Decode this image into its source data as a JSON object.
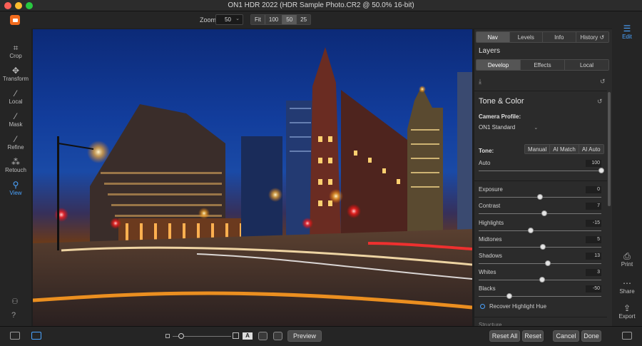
{
  "window": {
    "title": "ON1 HDR 2022 (HDR Sample Photo.CR2 @ 50.0% 16-bit)"
  },
  "toolbar": {
    "zoom_label": "Zoom",
    "zoom_value": "50",
    "zoom_presets": [
      "Fit",
      "100",
      "50",
      "25"
    ]
  },
  "left_tools": [
    {
      "label": "Crop",
      "icon": "crop-icon"
    },
    {
      "label": "Transform",
      "icon": "transform-icon"
    },
    {
      "label": "Local",
      "icon": "brush-icon"
    },
    {
      "label": "Mask",
      "icon": "mask-brush-icon"
    },
    {
      "label": "Refine",
      "icon": "refine-brush-icon"
    },
    {
      "label": "Retouch",
      "icon": "retouch-icon"
    },
    {
      "label": "View",
      "icon": "view-zoom-icon"
    }
  ],
  "panel": {
    "tabs": [
      "Nav",
      "Levels",
      "Info",
      "History"
    ],
    "layers_title": "Layers",
    "subtabs": [
      "Develop",
      "Effects",
      "Local"
    ],
    "section_title": "Tone & Color",
    "camera_profile_label": "Camera Profile:",
    "camera_profile_value": "ON1 Standard",
    "tone_label": "Tone:",
    "tone_buttons": [
      "Manual",
      "AI Match",
      "AI Auto"
    ],
    "sliders": [
      {
        "name": "Auto",
        "value": "100",
        "position": 1.0
      },
      {
        "name": "Exposure",
        "value": "0",
        "position": 0.5
      },
      {
        "name": "Contrast",
        "value": "7",
        "position": 0.535
      },
      {
        "name": "Highlights",
        "value": "-15",
        "position": 0.425
      },
      {
        "name": "Midtones",
        "value": "5",
        "position": 0.525
      },
      {
        "name": "Shadows",
        "value": "13",
        "position": 0.565
      },
      {
        "name": "Whites",
        "value": "3",
        "position": 0.515
      },
      {
        "name": "Blacks",
        "value": "-50",
        "position": 0.25
      }
    ],
    "recover_label": "Recover Highlight Hue",
    "structure_label": "Structure"
  },
  "right_modules": [
    {
      "label": "Edit",
      "icon": "edit-sliders-icon"
    },
    {
      "label": "Print",
      "icon": "printer-icon"
    },
    {
      "label": "Share",
      "icon": "share-icon"
    },
    {
      "label": "Export",
      "icon": "export-icon"
    }
  ],
  "bottom": {
    "preview": "Preview",
    "reset_all": "Reset All",
    "reset": "Reset",
    "cancel": "Cancel",
    "done": "Done",
    "a_badge": "A"
  },
  "colors": {
    "accent": "#4aa3ff",
    "logo": "#f26b1d"
  }
}
